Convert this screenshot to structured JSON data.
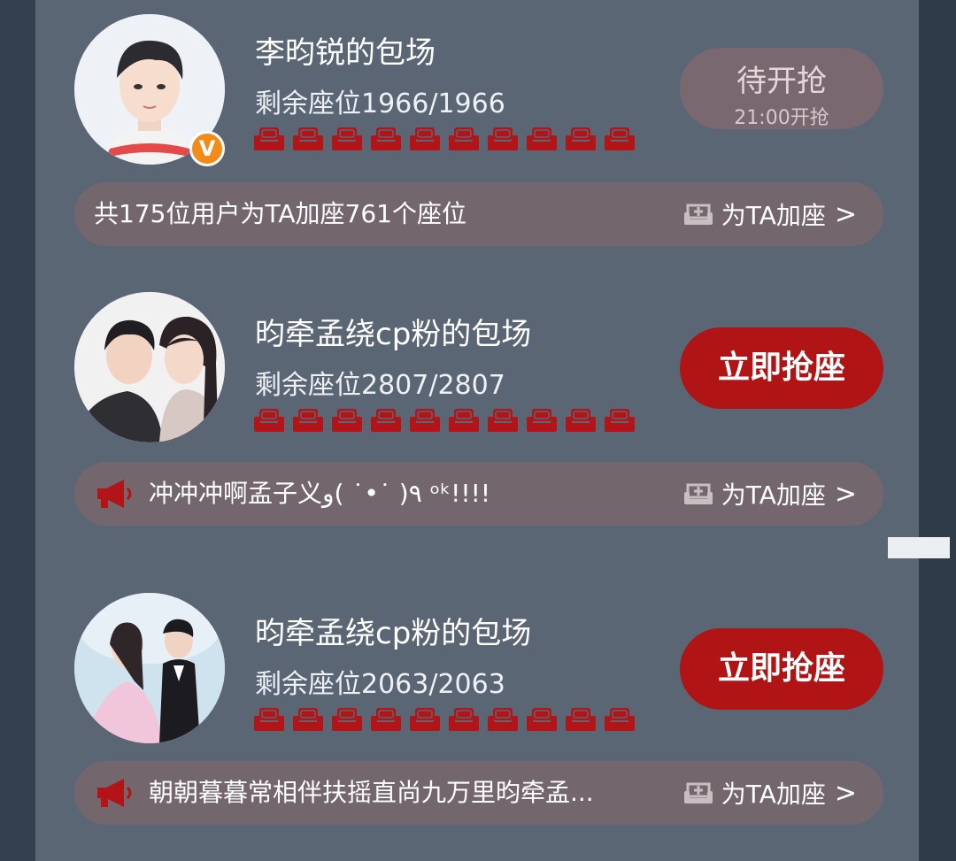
{
  "cards": [
    {
      "title": "李昀锐的包场",
      "seats_text": "剩余座位1966/1966",
      "seats_remaining": 1966,
      "seats_total": 1966,
      "verified_badge": "V",
      "button": {
        "state": "waiting",
        "label": "待开抢",
        "sub_label": "21:00开抢"
      },
      "bar": {
        "has_horn_icon": false,
        "text": "共175位用户为TA加座761个座位",
        "action_label": "为TA加座"
      },
      "avatar_icon": "person-avatar"
    },
    {
      "title": "昀牵孟绕cp粉的包场",
      "seats_text": "剩余座位2807/2807",
      "seats_remaining": 2807,
      "seats_total": 2807,
      "button": {
        "state": "active",
        "label": "立即抢座"
      },
      "bar": {
        "has_horn_icon": true,
        "text": "冲冲冲啊孟子义٩( ˙•˙ )و ᵒᵏ!!!!",
        "action_label": "为TA加座"
      },
      "avatar_icon": "couple-avatar"
    },
    {
      "title": "昀牵孟绕cp粉的包场",
      "seats_text": "剩余座位2063/2063",
      "seats_remaining": 2063,
      "seats_total": 2063,
      "button": {
        "state": "active",
        "label": "立即抢座"
      },
      "bar": {
        "has_horn_icon": true,
        "text": "朝朝暮暮常相伴扶摇直尚九万里昀牵孟...",
        "action_label": "为TA加座"
      },
      "avatar_icon": "couple-wedding-avatar"
    }
  ],
  "chevron": ">",
  "colors": {
    "seat_icon": "#b21418",
    "grab_button": "#b01414",
    "wait_button": "#79686f",
    "bar_bg": "#74666d",
    "panel_bg": "#5b6675"
  },
  "seat_icons_per_row": 10
}
